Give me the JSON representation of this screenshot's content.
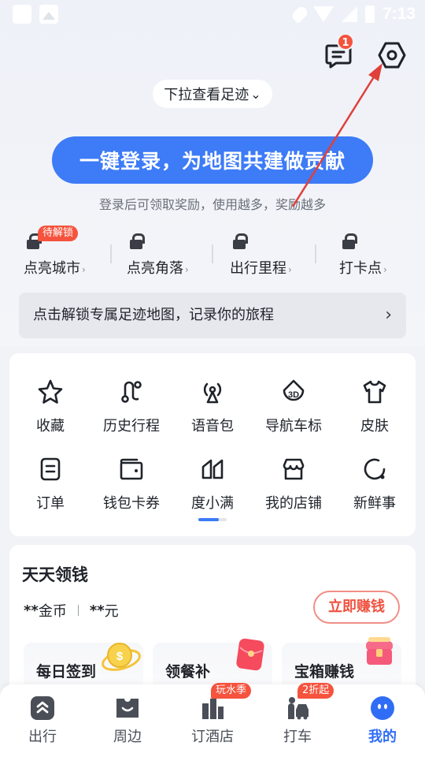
{
  "status_bar": {
    "time": "7:13"
  },
  "header": {
    "message_badge": "1"
  },
  "pull_hint": {
    "text": "下拉查看足迹",
    "chevron": "⌄"
  },
  "login": {
    "button_label": "一键登录，为地图共建做贡献",
    "hint": "登录后可领取奖励，使用越多，奖励越多"
  },
  "stats": {
    "unlock_tag": "待解锁",
    "items": [
      {
        "label": "点亮城市",
        "arrow": "›"
      },
      {
        "label": "点亮角落",
        "arrow": "›"
      },
      {
        "label": "出行里程",
        "arrow": "›"
      },
      {
        "label": "打卡点",
        "arrow": "›"
      }
    ]
  },
  "footprint_banner": {
    "text": "点击解锁专属足迹地图，记录你的旅程",
    "chevron": "›"
  },
  "grid": {
    "items": [
      {
        "label": "收藏",
        "icon": "star-icon"
      },
      {
        "label": "历史行程",
        "icon": "route-icon"
      },
      {
        "label": "语音包",
        "icon": "voice-icon"
      },
      {
        "label": "导航车标",
        "icon": "3d-car-icon"
      },
      {
        "label": "皮肤",
        "icon": "tshirt-icon"
      },
      {
        "label": "订单",
        "icon": "order-icon"
      },
      {
        "label": "钱包卡券",
        "icon": "wallet-icon"
      },
      {
        "label": "度小满",
        "icon": "duxiaoman-icon"
      },
      {
        "label": "我的店铺",
        "icon": "store-icon"
      },
      {
        "label": "新鲜事",
        "icon": "news-icon"
      }
    ]
  },
  "earn": {
    "title": "天天领钱",
    "coins_value": "**",
    "coins_unit": "金币",
    "cash_value": "**",
    "cash_unit": "元",
    "button": "立即赚钱",
    "tasks": [
      {
        "label": "每日签到",
        "icon": "coin-icon"
      },
      {
        "label": "领餐补",
        "icon": "red-envelope-icon"
      },
      {
        "label": "宝箱赚钱",
        "icon": "treasure-chest-icon"
      }
    ]
  },
  "tabbar": {
    "items": [
      {
        "label": "出行",
        "icon": "travel-icon"
      },
      {
        "label": "周边",
        "icon": "nearby-icon"
      },
      {
        "label": "订酒店",
        "icon": "hotel-icon",
        "badge": "玩水季"
      },
      {
        "label": "打车",
        "icon": "taxi-icon",
        "badge": "2折起"
      },
      {
        "label": "我的",
        "icon": "profile-icon",
        "active": true
      }
    ]
  },
  "colors": {
    "primary": "#3d7bf7",
    "badge": "#f5533d",
    "annotation_arrow": "#e0403a"
  }
}
